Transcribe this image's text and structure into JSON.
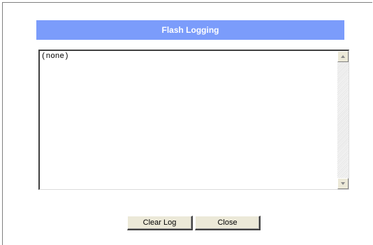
{
  "header": {
    "title": "Flash Logging"
  },
  "log": {
    "content": "(none)"
  },
  "buttons": {
    "clear_label": "Clear Log",
    "close_label": "Close"
  },
  "colors": {
    "title_bar": "#7b9cfb",
    "button_face": "#ece9d8"
  },
  "icons": {
    "scroll_up": "scroll-up-arrow-icon",
    "scroll_down": "scroll-down-arrow-icon"
  }
}
